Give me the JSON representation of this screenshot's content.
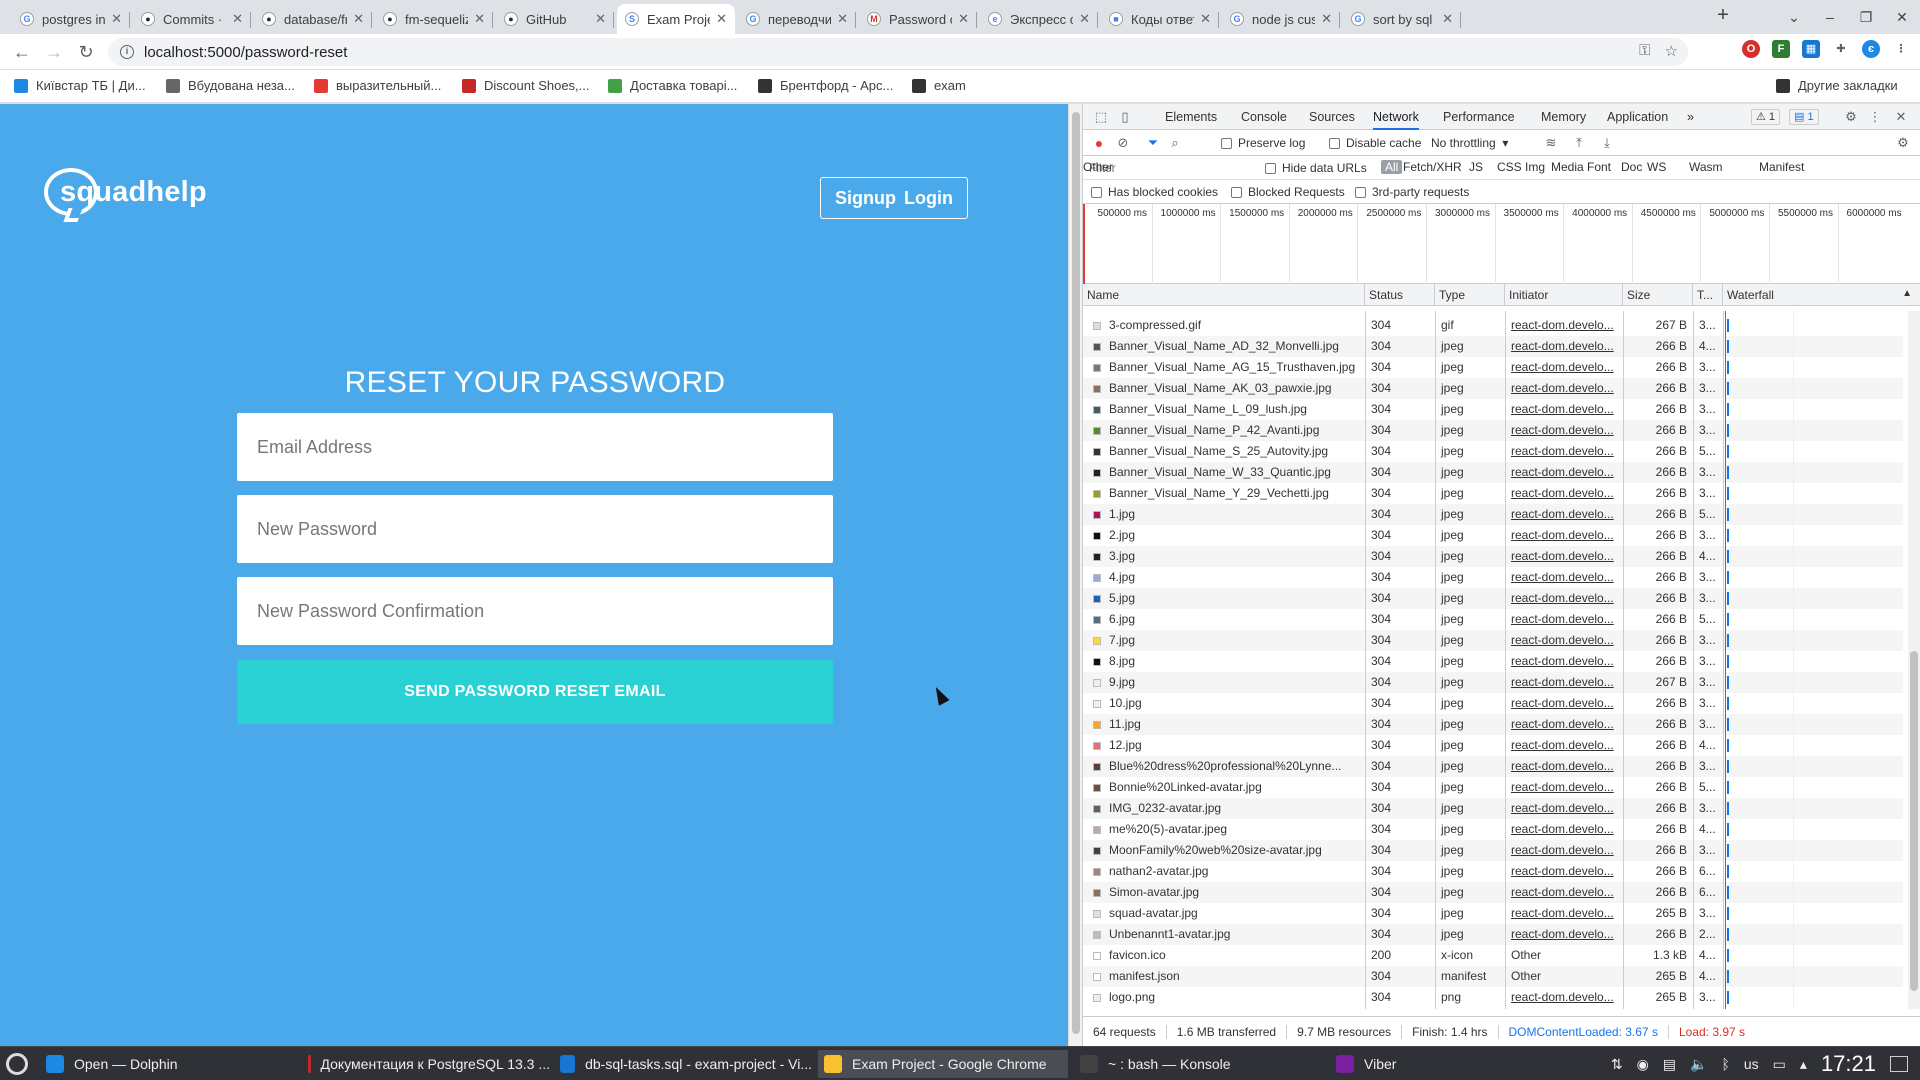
{
  "tabs": [
    {
      "title": "postgres ins",
      "fav": "G",
      "active": false
    },
    {
      "title": "Commits · Ev",
      "fav": "gh",
      "active": false
    },
    {
      "title": "database/fm",
      "fav": "gh",
      "active": false
    },
    {
      "title": "fm-sequelize",
      "fav": "gh",
      "active": false
    },
    {
      "title": "GitHub",
      "fav": "gh",
      "active": false
    },
    {
      "title": "Exam Project",
      "fav": "S",
      "active": true
    },
    {
      "title": "переводчик",
      "fav": "G",
      "active": false
    },
    {
      "title": "Password ch",
      "fav": "M",
      "active": false
    },
    {
      "title": "Экспресс об",
      "fav": "ex",
      "active": false
    },
    {
      "title": "Коды ответа",
      "fav": "md",
      "active": false
    },
    {
      "title": "node js cust",
      "fav": "G",
      "active": false
    },
    {
      "title": "sort by sql -",
      "fav": "G",
      "active": false
    }
  ],
  "toolbar": {
    "url": "localhost:5000/password-reset",
    "new_tab": "+",
    "back": "←",
    "forward": "→",
    "reload": "↻"
  },
  "bookmarks": [
    {
      "label": "Київстар ТБ | Ди...",
      "color": "#1e88e5"
    },
    {
      "label": "Вбудована неза...",
      "color": "#666"
    },
    {
      "label": "выразительный...",
      "color": "#e53935"
    },
    {
      "label": "Discount Shoes,...",
      "color": "#c62828"
    },
    {
      "label": "Доставка товарі...",
      "color": "#43a047"
    },
    {
      "label": "Брентфорд - Арс...",
      "color": "#333"
    },
    {
      "label": "exam",
      "color": "#333"
    }
  ],
  "other_bookmarks": "Другие закладки",
  "page": {
    "logo": "squadhelp",
    "signup": "Signup",
    "login": "Login",
    "title": "RESET YOUR PASSWORD",
    "email_placeholder": "Email Address",
    "password_placeholder": "New Password",
    "confirm_placeholder": "New Password Confirmation",
    "submit": "SEND PASSWORD RESET EMAIL"
  },
  "devtools": {
    "tabs": [
      "Elements",
      "Console",
      "Sources",
      "Network",
      "Performance",
      "Memory",
      "Application"
    ],
    "active_tab": "Network",
    "more_tabs": "»",
    "warnings": "1",
    "messages": "1",
    "preserve_log": "Preserve log",
    "disable_cache": "Disable cache",
    "throttling": "No throttling",
    "filter_placeholder": "Filter",
    "hide_data_urls": "Hide data URLs",
    "filter_types": [
      "All",
      "Fetch/XHR",
      "JS",
      "CSS",
      "Img",
      "Media",
      "Font",
      "Doc",
      "WS",
      "Wasm",
      "Manifest",
      "Other"
    ],
    "has_blocked_cookies": "Has blocked cookies",
    "blocked_requests": "Blocked Requests",
    "third_party": "3rd-party requests",
    "timeline_ticks": [
      "500000 ms",
      "1000000 ms",
      "1500000 ms",
      "2000000 ms",
      "2500000 ms",
      "3000000 ms",
      "3500000 ms",
      "4000000 ms",
      "4500000 ms",
      "5000000 ms",
      "5500000 ms",
      "6000000 ms"
    ],
    "columns": {
      "name": "Name",
      "status": "Status",
      "type": "Type",
      "initiator": "Initiator",
      "size": "Size",
      "time": "T...",
      "waterfall": "Waterfall"
    },
    "requests": [
      {
        "name": "3-compressed.gif",
        "status": "304",
        "type": "gif",
        "initiator": "react-dom.develo...",
        "size": "267 B",
        "time": "3...",
        "color": "#ddd"
      },
      {
        "name": "Banner_Visual_Name_AD_32_Monvelli.jpg",
        "status": "304",
        "type": "jpeg",
        "initiator": "react-dom.develo...",
        "size": "266 B",
        "time": "4...",
        "color": "#555"
      },
      {
        "name": "Banner_Visual_Name_AG_15_Trusthaven.jpg",
        "status": "304",
        "type": "jpeg",
        "initiator": "react-dom.develo...",
        "size": "266 B",
        "time": "3...",
        "color": "#777"
      },
      {
        "name": "Banner_Visual_Name_AK_03_pawxie.jpg",
        "status": "304",
        "type": "jpeg",
        "initiator": "react-dom.develo...",
        "size": "266 B",
        "time": "3...",
        "color": "#8d6e63"
      },
      {
        "name": "Banner_Visual_Name_L_09_lush.jpg",
        "status": "304",
        "type": "jpeg",
        "initiator": "react-dom.develo...",
        "size": "266 B",
        "time": "3...",
        "color": "#455a64"
      },
      {
        "name": "Banner_Visual_Name_P_42_Avanti.jpg",
        "status": "304",
        "type": "jpeg",
        "initiator": "react-dom.develo...",
        "size": "266 B",
        "time": "3...",
        "color": "#558b2f"
      },
      {
        "name": "Banner_Visual_Name_S_25_Autovity.jpg",
        "status": "304",
        "type": "jpeg",
        "initiator": "react-dom.develo...",
        "size": "266 B",
        "time": "5...",
        "color": "#333"
      },
      {
        "name": "Banner_Visual_Name_W_33_Quantic.jpg",
        "status": "304",
        "type": "jpeg",
        "initiator": "react-dom.develo...",
        "size": "266 B",
        "time": "3...",
        "color": "#222"
      },
      {
        "name": "Banner_Visual_Name_Y_29_Vechetti.jpg",
        "status": "304",
        "type": "jpeg",
        "initiator": "react-dom.develo...",
        "size": "266 B",
        "time": "3...",
        "color": "#9e9d24"
      },
      {
        "name": "1.jpg",
        "status": "304",
        "type": "jpeg",
        "initiator": "react-dom.develo...",
        "size": "266 B",
        "time": "5...",
        "color": "#ad1457"
      },
      {
        "name": "2.jpg",
        "status": "304",
        "type": "jpeg",
        "initiator": "react-dom.develo...",
        "size": "266 B",
        "time": "3...",
        "color": "#111"
      },
      {
        "name": "3.jpg",
        "status": "304",
        "type": "jpeg",
        "initiator": "react-dom.develo...",
        "size": "266 B",
        "time": "4...",
        "color": "#222"
      },
      {
        "name": "4.jpg",
        "status": "304",
        "type": "jpeg",
        "initiator": "react-dom.develo...",
        "size": "266 B",
        "time": "3...",
        "color": "#9fa8da"
      },
      {
        "name": "5.jpg",
        "status": "304",
        "type": "jpeg",
        "initiator": "react-dom.develo...",
        "size": "266 B",
        "time": "3...",
        "color": "#1565c0"
      },
      {
        "name": "6.jpg",
        "status": "304",
        "type": "jpeg",
        "initiator": "react-dom.develo...",
        "size": "266 B",
        "time": "5...",
        "color": "#546e7a"
      },
      {
        "name": "7.jpg",
        "status": "304",
        "type": "jpeg",
        "initiator": "react-dom.develo...",
        "size": "266 B",
        "time": "3...",
        "color": "#fdd835"
      },
      {
        "name": "8.jpg",
        "status": "304",
        "type": "jpeg",
        "initiator": "react-dom.develo...",
        "size": "266 B",
        "time": "3...",
        "color": "#111"
      },
      {
        "name": "9.jpg",
        "status": "304",
        "type": "jpeg",
        "initiator": "react-dom.develo...",
        "size": "267 B",
        "time": "3...",
        "color": "#eee"
      },
      {
        "name": "10.jpg",
        "status": "304",
        "type": "jpeg",
        "initiator": "react-dom.develo...",
        "size": "266 B",
        "time": "3...",
        "color": "#eee"
      },
      {
        "name": "11.jpg",
        "status": "304",
        "type": "jpeg",
        "initiator": "react-dom.develo...",
        "size": "266 B",
        "time": "3...",
        "color": "#f9a825"
      },
      {
        "name": "12.jpg",
        "status": "304",
        "type": "jpeg",
        "initiator": "react-dom.develo...",
        "size": "266 B",
        "time": "4...",
        "color": "#e57373"
      },
      {
        "name": "Blue%20dress%20professional%20Lynne...",
        "status": "304",
        "type": "jpeg",
        "initiator": "react-dom.develo...",
        "size": "266 B",
        "time": "3...",
        "color": "#5d4037"
      },
      {
        "name": "Bonnie%20Linked-avatar.jpg",
        "status": "304",
        "type": "jpeg",
        "initiator": "react-dom.develo...",
        "size": "266 B",
        "time": "5...",
        "color": "#6d4c41"
      },
      {
        "name": "IMG_0232-avatar.jpg",
        "status": "304",
        "type": "jpeg",
        "initiator": "react-dom.develo...",
        "size": "266 B",
        "time": "3...",
        "color": "#616161"
      },
      {
        "name": "me%20(5)-avatar.jpeg",
        "status": "304",
        "type": "jpeg",
        "initiator": "react-dom.develo...",
        "size": "266 B",
        "time": "4...",
        "color": "#bcaaa4"
      },
      {
        "name": "MoonFamily%20web%20size-avatar.jpg",
        "status": "304",
        "type": "jpeg",
        "initiator": "react-dom.develo...",
        "size": "266 B",
        "time": "3...",
        "color": "#424242"
      },
      {
        "name": "nathan2-avatar.jpg",
        "status": "304",
        "type": "jpeg",
        "initiator": "react-dom.develo...",
        "size": "266 B",
        "time": "6...",
        "color": "#a1887f"
      },
      {
        "name": "Simon-avatar.jpg",
        "status": "304",
        "type": "jpeg",
        "initiator": "react-dom.develo...",
        "size": "266 B",
        "time": "6...",
        "color": "#8d6e63"
      },
      {
        "name": "squad-avatar.jpg",
        "status": "304",
        "type": "jpeg",
        "initiator": "react-dom.develo...",
        "size": "265 B",
        "time": "3...",
        "color": "#e0e0e0"
      },
      {
        "name": "Unbenannt1-avatar.jpg",
        "status": "304",
        "type": "jpeg",
        "initiator": "react-dom.develo...",
        "size": "266 B",
        "time": "2...",
        "color": "#bdbdbd"
      },
      {
        "name": "favicon.ico",
        "status": "200",
        "type": "x-icon",
        "initiator": "Other",
        "size": "1.3 kB",
        "time": "4...",
        "color": "#fff"
      },
      {
        "name": "manifest.json",
        "status": "304",
        "type": "manifest",
        "initiator": "Other",
        "size": "265 B",
        "time": "4...",
        "color": "#fff"
      },
      {
        "name": "logo.png",
        "status": "304",
        "type": "png",
        "initiator": "react-dom.develo...",
        "size": "265 B",
        "time": "3...",
        "color": "#eee"
      }
    ],
    "summary": {
      "requests": "64 requests",
      "transferred": "1.6 MB transferred",
      "resources": "9.7 MB resources",
      "finish": "Finish: 1.4 hrs",
      "dcl": "DOMContentLoaded: 3.67 s",
      "load": "Load: 3.97 s"
    }
  },
  "taskbar": {
    "items": [
      {
        "label": "Open — Dolphin",
        "color": "#1e88e5",
        "active": false
      },
      {
        "label": "Документация к PostgreSQL 13.3 ...",
        "color": "#c62828",
        "active": false
      },
      {
        "label": "db-sql-tasks.sql - exam-project - Vi...",
        "color": "#1976d2",
        "active": false
      },
      {
        "label": "Exam Project - Google Chrome",
        "color": "#fbc02d",
        "active": true
      },
      {
        "label": "~ : bash — Konsole",
        "color": "#424242",
        "active": false
      },
      {
        "label": "Viber",
        "color": "#7b1fa2",
        "active": false
      }
    ],
    "lang": "us",
    "time": "17:21"
  }
}
